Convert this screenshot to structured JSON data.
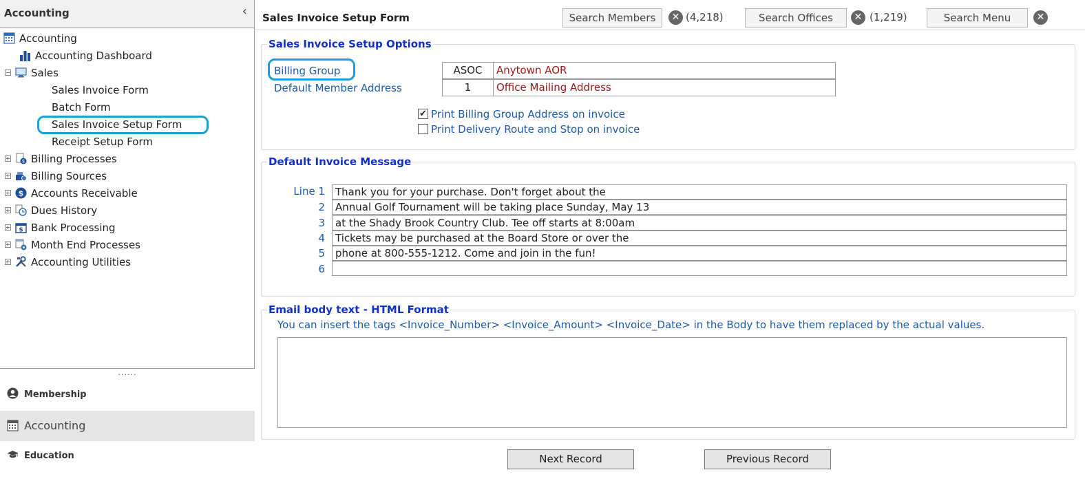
{
  "sidebar": {
    "title": "Accounting",
    "collapse_glyph": "‹",
    "tree": {
      "root": "Accounting",
      "dashboard": "Accounting Dashboard",
      "sales": "Sales",
      "sales_children": [
        "Sales Invoice Form",
        "Batch Form",
        "Sales Invoice Setup Form",
        "Receipt Setup Form"
      ],
      "billing_processes": "Billing Processes",
      "billing_sources": "Billing Sources",
      "accounts_receivable": "Accounts Receivable",
      "dues_history": "Dues History",
      "bank_processing": "Bank Processing",
      "month_end": "Month End Processes",
      "utilities": "Accounting Utilities"
    },
    "splitter": "......",
    "nav": {
      "membership": "Membership",
      "accounting": "Accounting",
      "education": "Education"
    }
  },
  "header": {
    "form_title": "Sales Invoice Setup Form",
    "search_members": "Search Members",
    "members_count": "(4,218)",
    "search_offices": "Search Offices",
    "offices_count": "(1,219)",
    "search_menu": "Search Menu",
    "clear_glyph": "✕"
  },
  "setup": {
    "legend": "Sales Invoice Setup Options",
    "billing_group_label": "Billing Group",
    "billing_group_code": "ASOC",
    "billing_group_name": "Anytown AOR",
    "member_address_label": "Default Member Address",
    "member_address_code": "1",
    "member_address_name": "Office Mailing Address",
    "print_billing_address_label": "Print Billing Group Address on invoice",
    "print_billing_address_checked": true,
    "print_route_label": "Print Delivery Route and Stop on invoice",
    "print_route_checked": false,
    "check_glyph": "✔"
  },
  "message": {
    "legend": "Default Invoice Message",
    "line_labels": [
      "Line 1",
      "2",
      "3",
      "4",
      "5",
      "6"
    ],
    "lines": [
      "Thank you for your purchase.  Don't forget about the",
      "Annual Golf Tournament will be taking place Sunday, May 13",
      "at the Shady Brook Country Club.  Tee off starts at 8:00am",
      "Tickets may be purchased at the Board Store or over the",
      "phone at 800-555-1212.  Come and join in the fun!",
      ""
    ]
  },
  "email": {
    "legend": "Email body text - HTML Format",
    "hint": "You can insert the tags <Invoice_Number> <Invoice_Amount> <Invoice_Date> in the Body to have them replaced by the actual values.",
    "body": ""
  },
  "footer": {
    "next": "Next Record",
    "previous": "Previous Record"
  },
  "colors": {
    "legend_blue": "#1030c8",
    "label_blue": "#1e5aa8",
    "value_red": "#a01818",
    "highlight": "#1aa0d8"
  }
}
